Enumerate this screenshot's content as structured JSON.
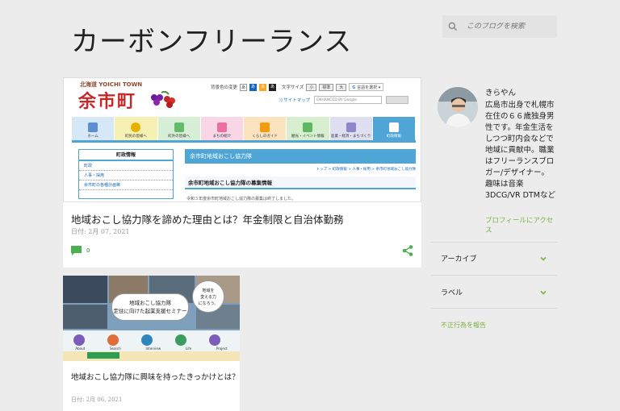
{
  "blog": {
    "title": "カーボンフリーランス"
  },
  "search": {
    "placeholder": "このブログを検索"
  },
  "featured_post": {
    "title": "地域おこし協力隊を諦めた理由とは？年金制限と自治体勤務",
    "date": "日付: 2月 07, 2021",
    "comment_count": "0",
    "thumbnail": {
      "logo_small": "北海道 YOICHI TOWN",
      "logo_big": "余市町",
      "util": {
        "bgcolor_label": "背景色の変更",
        "swatch_labels": [
          "あ",
          "あ",
          "あ",
          "あ"
        ],
        "fontsize_label": "文字サイズ",
        "sizes": [
          "小",
          "標準",
          "大"
        ],
        "translate": "言語を選択"
      },
      "sitemap": "サイトマップ",
      "search_hint": "ENHANCED BY Google",
      "nav": [
        "ホーム",
        "町民の皆様へ",
        "町外の皆様へ",
        "まちの紹介",
        "くらしのガイド",
        "観光・イベント情報",
        "産業・経済・まちづくり",
        "町政情報"
      ],
      "side_title": "町政情報",
      "side_items": [
        "町政",
        "人事・採用",
        "余市町の各種計画等"
      ],
      "main_header": "余市町地域おこし協力隊",
      "breadcrumb": "トップ > 町政情報 > 人事・採用 > 余市町地域おこし協力隊",
      "sub_header": "余市町地域おこし協力隊の募集情報",
      "body_text": "令和３年度余市町地域おこし協力隊の募集は終了しました。"
    }
  },
  "second_post": {
    "title": "地域おこし協力隊に興味を持ったきっかけとは？",
    "date": "日付: 2月 06, 2021",
    "thumbnail": {
      "bubble_left": "地域おこし協力隊\n定住に向けた起業支援セミナー",
      "bubble_right": "地域を\n変える力\nになろう。",
      "icons": [
        "About",
        "Search",
        "Interview",
        "Life",
        "Project"
      ]
    }
  },
  "sidebar": {
    "author_name": "きらやん",
    "author_bio": "広島市出身で札幌市在住の６６歳独身男性です。年金生活をしつつ町内会などで地域に貢献中。職業はフリーランスブロガー/デザイナー。趣味は音楽 3DCG/VR DTMなど",
    "profile_link": "プロフィールにアクセス",
    "archive_label": "アーカイブ",
    "labels_label": "ラベル",
    "report_label": "不正行為を報告"
  },
  "colors": {
    "accent_green": "#7cb342",
    "nav_blue": "#4fa6d6",
    "background": "#ececec"
  }
}
